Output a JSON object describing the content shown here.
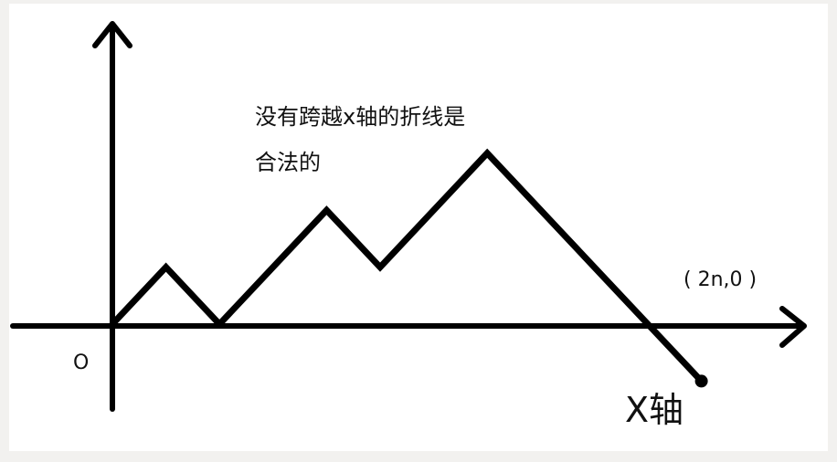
{
  "annotation": {
    "line1": "没有跨越x轴的折线是",
    "line2": "合法的"
  },
  "origin_label": "O",
  "endpoint_label": "( 2n,0 )",
  "x_axis_label": "X轴",
  "path_steps": [
    1,
    1,
    -1,
    -1,
    1,
    1,
    1,
    1,
    -1,
    -1,
    1,
    1,
    1,
    1,
    -1,
    -1,
    -1,
    -1,
    -1,
    -1,
    -1,
    -1
  ],
  "colors": {
    "stroke": "#000000",
    "background": "#ffffff"
  }
}
